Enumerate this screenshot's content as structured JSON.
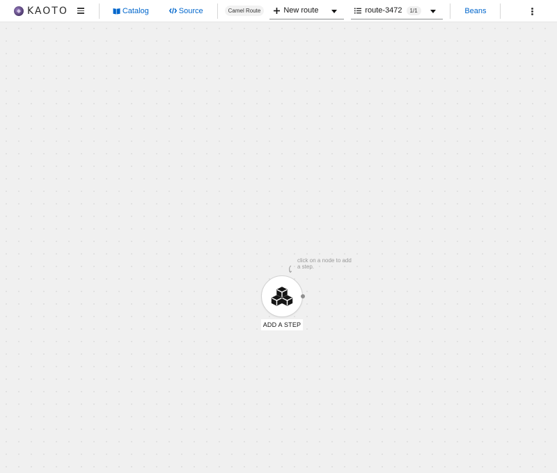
{
  "app": {
    "logo_text": "KAOTO"
  },
  "toolbar": {
    "catalog_label": "Catalog",
    "source_label": "Source",
    "dsl_chip": "Camel Route",
    "new_route_label": "New route",
    "route_name": "route-3472",
    "route_count": "1/1",
    "beans_label": "Beans"
  },
  "canvas": {
    "hint_text": "click on a node to add a step.",
    "node_label": "ADD A STEP"
  },
  "colors": {
    "link": "#0066cc",
    "canvas_bg": "#f0f0f0",
    "toolbar_bg": "#ffffff"
  }
}
